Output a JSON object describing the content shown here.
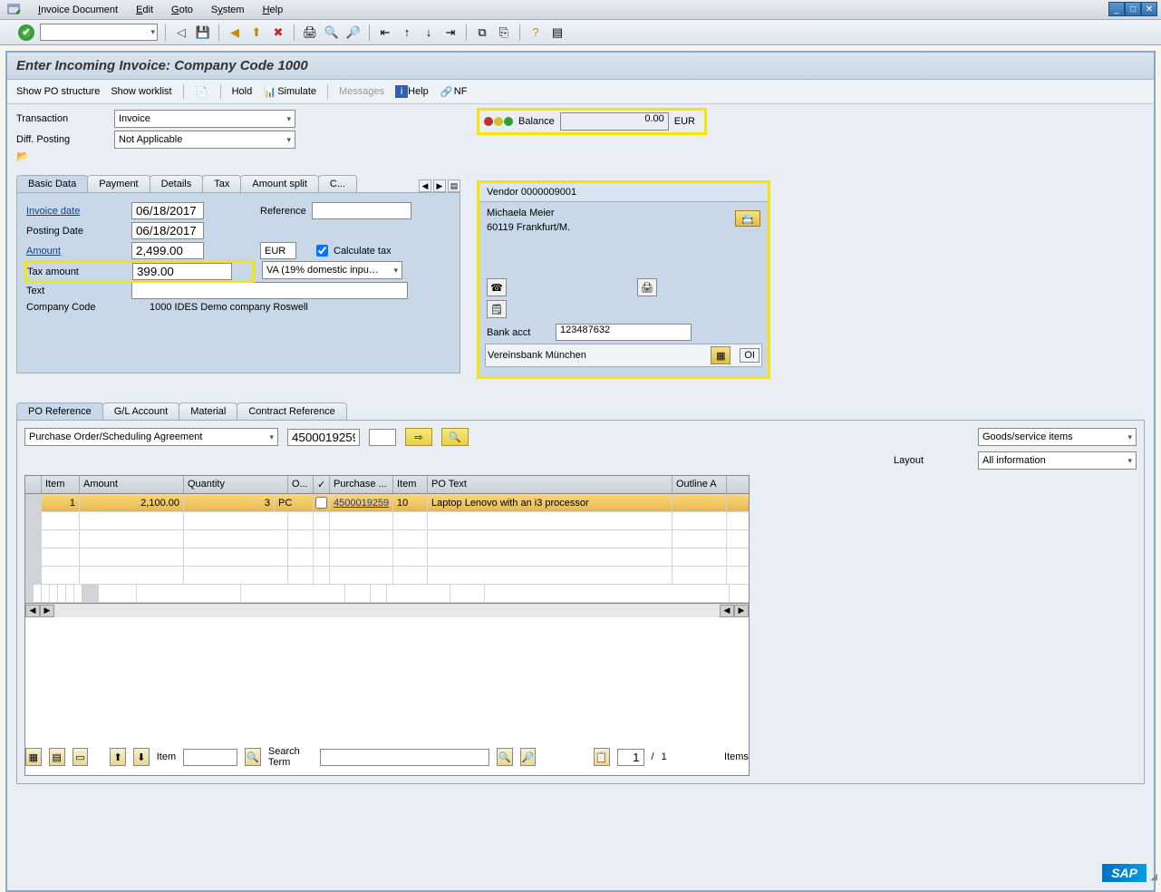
{
  "menubar": {
    "items": [
      "Invoice Document",
      "Edit",
      "Goto",
      "System",
      "Help"
    ]
  },
  "page_title": "Enter Incoming Invoice: Company Code 1000",
  "action_bar": {
    "show_po_structure": "Show PO structure",
    "show_worklist": "Show worklist",
    "hold": "Hold",
    "simulate": "Simulate",
    "messages": "Messages",
    "help": "Help",
    "nf": "NF"
  },
  "transaction_label": "Transaction",
  "transaction_value": "Invoice",
  "diff_posting_label": "Diff. Posting",
  "diff_posting_value": "Not Applicable",
  "balance": {
    "label": "Balance",
    "value": "0.00",
    "currency": "EUR"
  },
  "tabs_upper": [
    "Basic Data",
    "Payment",
    "Details",
    "Tax",
    "Amount split",
    "C..."
  ],
  "basic_data": {
    "invoice_date_label": "Invoice date",
    "invoice_date": "06/18/2017",
    "reference_label": "Reference",
    "reference": "",
    "posting_date_label": "Posting Date",
    "posting_date": "06/18/2017",
    "amount_label": "Amount",
    "amount": "2,499.00",
    "currency": "EUR",
    "calc_tax_label": "Calculate tax",
    "tax_amount_label": "Tax amount",
    "tax_amount": "399.00",
    "tax_code": "VA (19% domestic inpu…",
    "text_label": "Text",
    "text": "",
    "company_code_label": "Company Code",
    "company_code": "1000 IDES Demo company Roswell"
  },
  "vendor": {
    "header": "Vendor 0000009001",
    "name": "Michaela Meier",
    "address": "60119 Frankfurt/M.",
    "bank_acct_label": "Bank acct",
    "bank_acct": "123487632",
    "bank_name": "Vereinsbank München",
    "oi": "OI"
  },
  "tabs_lower": [
    "PO Reference",
    "G/L Account",
    "Material",
    "Contract Reference"
  ],
  "po_ref": {
    "ref_type": "Purchase Order/Scheduling Agreement",
    "po_number": "4500019259",
    "goods_service": "Goods/service items",
    "layout_label": "Layout",
    "layout_value": "All information",
    "columns": [
      "Item",
      "Amount",
      "Quantity",
      "O...",
      "",
      "Purchase ...",
      "Item",
      "PO Text",
      "Outline A"
    ],
    "rows": [
      {
        "item": "1",
        "amount": "2,100.00",
        "quantity": "3",
        "unit": "PC",
        "flag": "",
        "po": "4500019259",
        "po_item": "10",
        "po_text": "Laptop Lenovo with an i3 processor",
        "outline": ""
      }
    ]
  },
  "footer": {
    "item_label": "Item",
    "search_term_label": "Search Term",
    "page_current": "1",
    "page_sep": "/",
    "page_total": "1",
    "items_label": "Items"
  }
}
